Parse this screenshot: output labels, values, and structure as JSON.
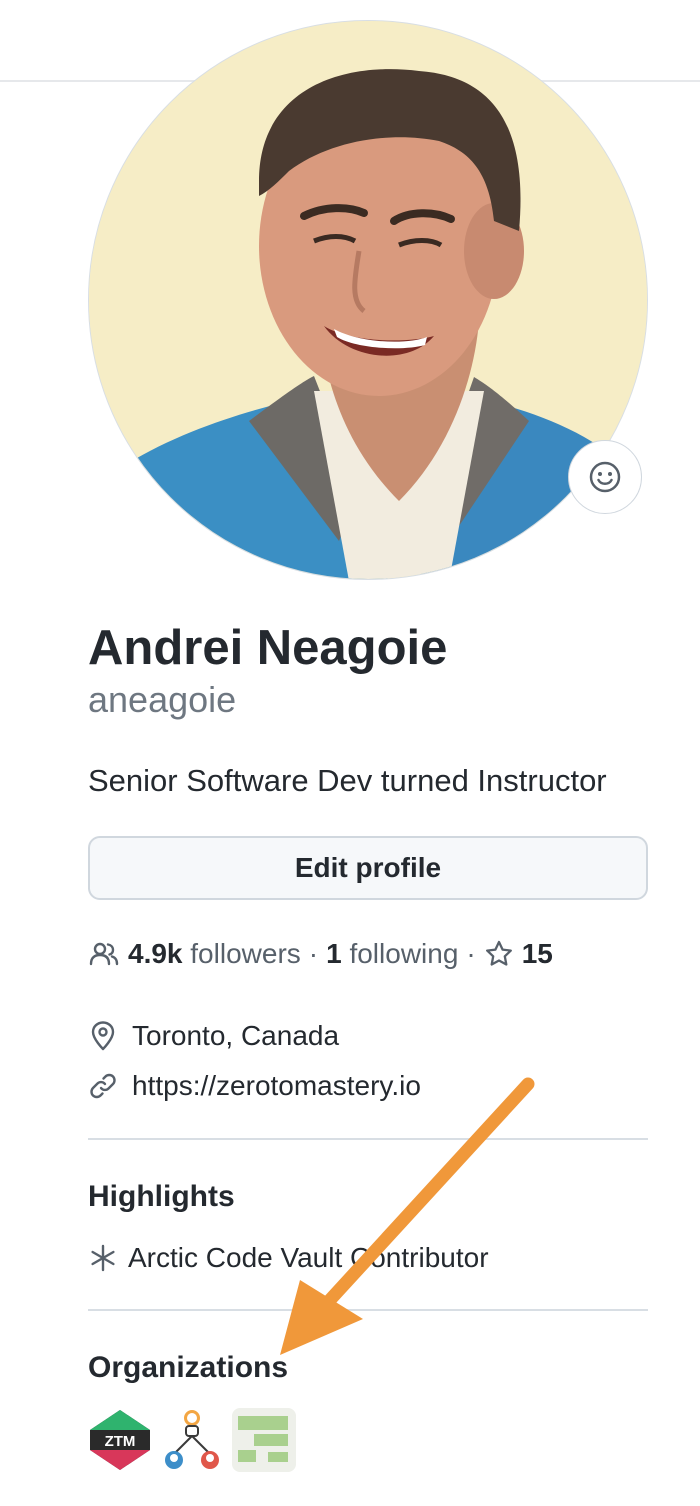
{
  "profile": {
    "full_name": "Andrei Neagoie",
    "username": "aneagoie",
    "bio": "Senior Software Dev turned Instructor",
    "edit_button_label": "Edit profile"
  },
  "social": {
    "followers_count": "4.9k",
    "followers_label": "followers",
    "separator": "·",
    "following_count": "1",
    "following_label": "following",
    "stars_count": "15"
  },
  "details": {
    "location": "Toronto, Canada",
    "website": "https://zerotomastery.io"
  },
  "highlights": {
    "title": "Highlights",
    "items": [
      {
        "label": "Arctic Code Vault Contributor",
        "icon": "snowflake-icon"
      }
    ]
  },
  "organizations": {
    "title": "Organizations",
    "items": [
      {
        "badge_text": "ZTM",
        "icon": "ztm-org-logo"
      },
      {
        "icon": "people-network-org-logo"
      },
      {
        "icon": "green-blocks-org-logo"
      }
    ]
  },
  "colors": {
    "annotation_arrow": "#f0983a",
    "muted_text": "#6e7781",
    "primary_text": "#24292f"
  }
}
